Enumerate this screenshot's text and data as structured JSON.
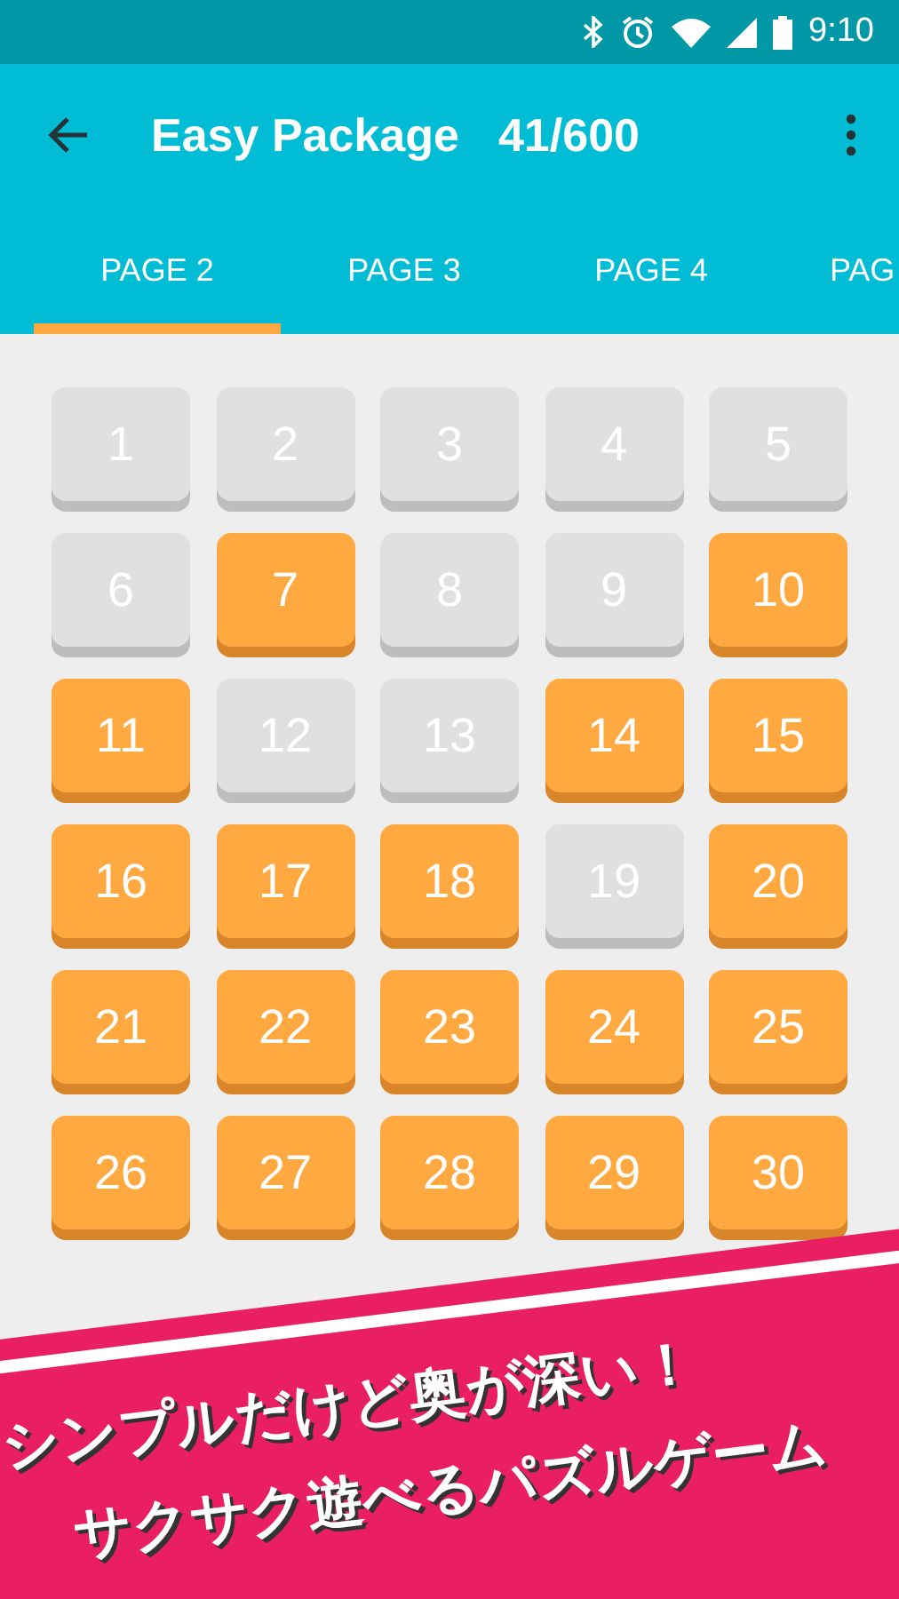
{
  "status_bar": {
    "time": "9:10"
  },
  "toolbar": {
    "title": "Easy Package",
    "progress": "41/600"
  },
  "tabs": [
    {
      "label": "PAGE 2",
      "selected": true
    },
    {
      "label": "PAGE 3",
      "selected": false
    },
    {
      "label": "PAGE 4",
      "selected": false
    },
    {
      "label": "PAG",
      "selected": false
    }
  ],
  "levels": [
    {
      "number": "1",
      "solved": false
    },
    {
      "number": "2",
      "solved": false
    },
    {
      "number": "3",
      "solved": false
    },
    {
      "number": "4",
      "solved": false
    },
    {
      "number": "5",
      "solved": false
    },
    {
      "number": "6",
      "solved": false
    },
    {
      "number": "7",
      "solved": true
    },
    {
      "number": "8",
      "solved": false
    },
    {
      "number": "9",
      "solved": false
    },
    {
      "number": "10",
      "solved": true
    },
    {
      "number": "11",
      "solved": true
    },
    {
      "number": "12",
      "solved": false
    },
    {
      "number": "13",
      "solved": false
    },
    {
      "number": "14",
      "solved": true
    },
    {
      "number": "15",
      "solved": true
    },
    {
      "number": "16",
      "solved": true
    },
    {
      "number": "17",
      "solved": true
    },
    {
      "number": "18",
      "solved": true
    },
    {
      "number": "19",
      "solved": false
    },
    {
      "number": "20",
      "solved": true
    },
    {
      "number": "21",
      "solved": true
    },
    {
      "number": "22",
      "solved": true
    },
    {
      "number": "23",
      "solved": true
    },
    {
      "number": "24",
      "solved": true
    },
    {
      "number": "25",
      "solved": true
    },
    {
      "number": "26",
      "solved": true
    },
    {
      "number": "27",
      "solved": true
    },
    {
      "number": "28",
      "solved": true
    },
    {
      "number": "29",
      "solved": true
    },
    {
      "number": "30",
      "solved": true
    }
  ],
  "banner": {
    "lines": [
      "シンプルだけど奥が深い！",
      "サクサク遊べるパズルゲーム"
    ]
  }
}
